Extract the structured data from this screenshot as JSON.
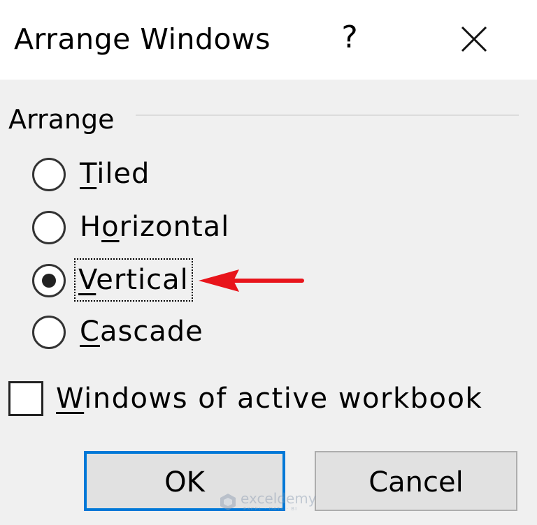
{
  "dialog": {
    "title": "Arrange Windows",
    "help_label": "?",
    "close_icon": "close-icon"
  },
  "arrange": {
    "group_label": "Arrange",
    "options": [
      {
        "label": "Tiled",
        "mnemonic": "T",
        "rest": "iled",
        "checked": false
      },
      {
        "label": "Horizontal",
        "prefix": "H",
        "mnemonic": "o",
        "rest": "rizontal",
        "checked": false
      },
      {
        "label": "Vertical",
        "mnemonic": "V",
        "rest": "ertical",
        "checked": true
      },
      {
        "label": "Cascade",
        "mnemonic": "C",
        "rest": "ascade",
        "checked": false
      }
    ]
  },
  "checkbox": {
    "label": "Windows of active workbook",
    "mnemonic": "W",
    "rest": "indows of active workbook",
    "checked": false
  },
  "buttons": {
    "ok_label": "OK",
    "cancel_label": "Cancel"
  },
  "annotation": {
    "arrow_color": "#e8141b",
    "icon": "red-arrow-icon"
  },
  "watermark": {
    "name": "exceldemy",
    "tagline": "EXCEL · DATA · BI"
  },
  "colors": {
    "accent": "#0078d7",
    "dialog_bg": "#f0f0f0",
    "titlebar_bg": "#ffffff"
  }
}
